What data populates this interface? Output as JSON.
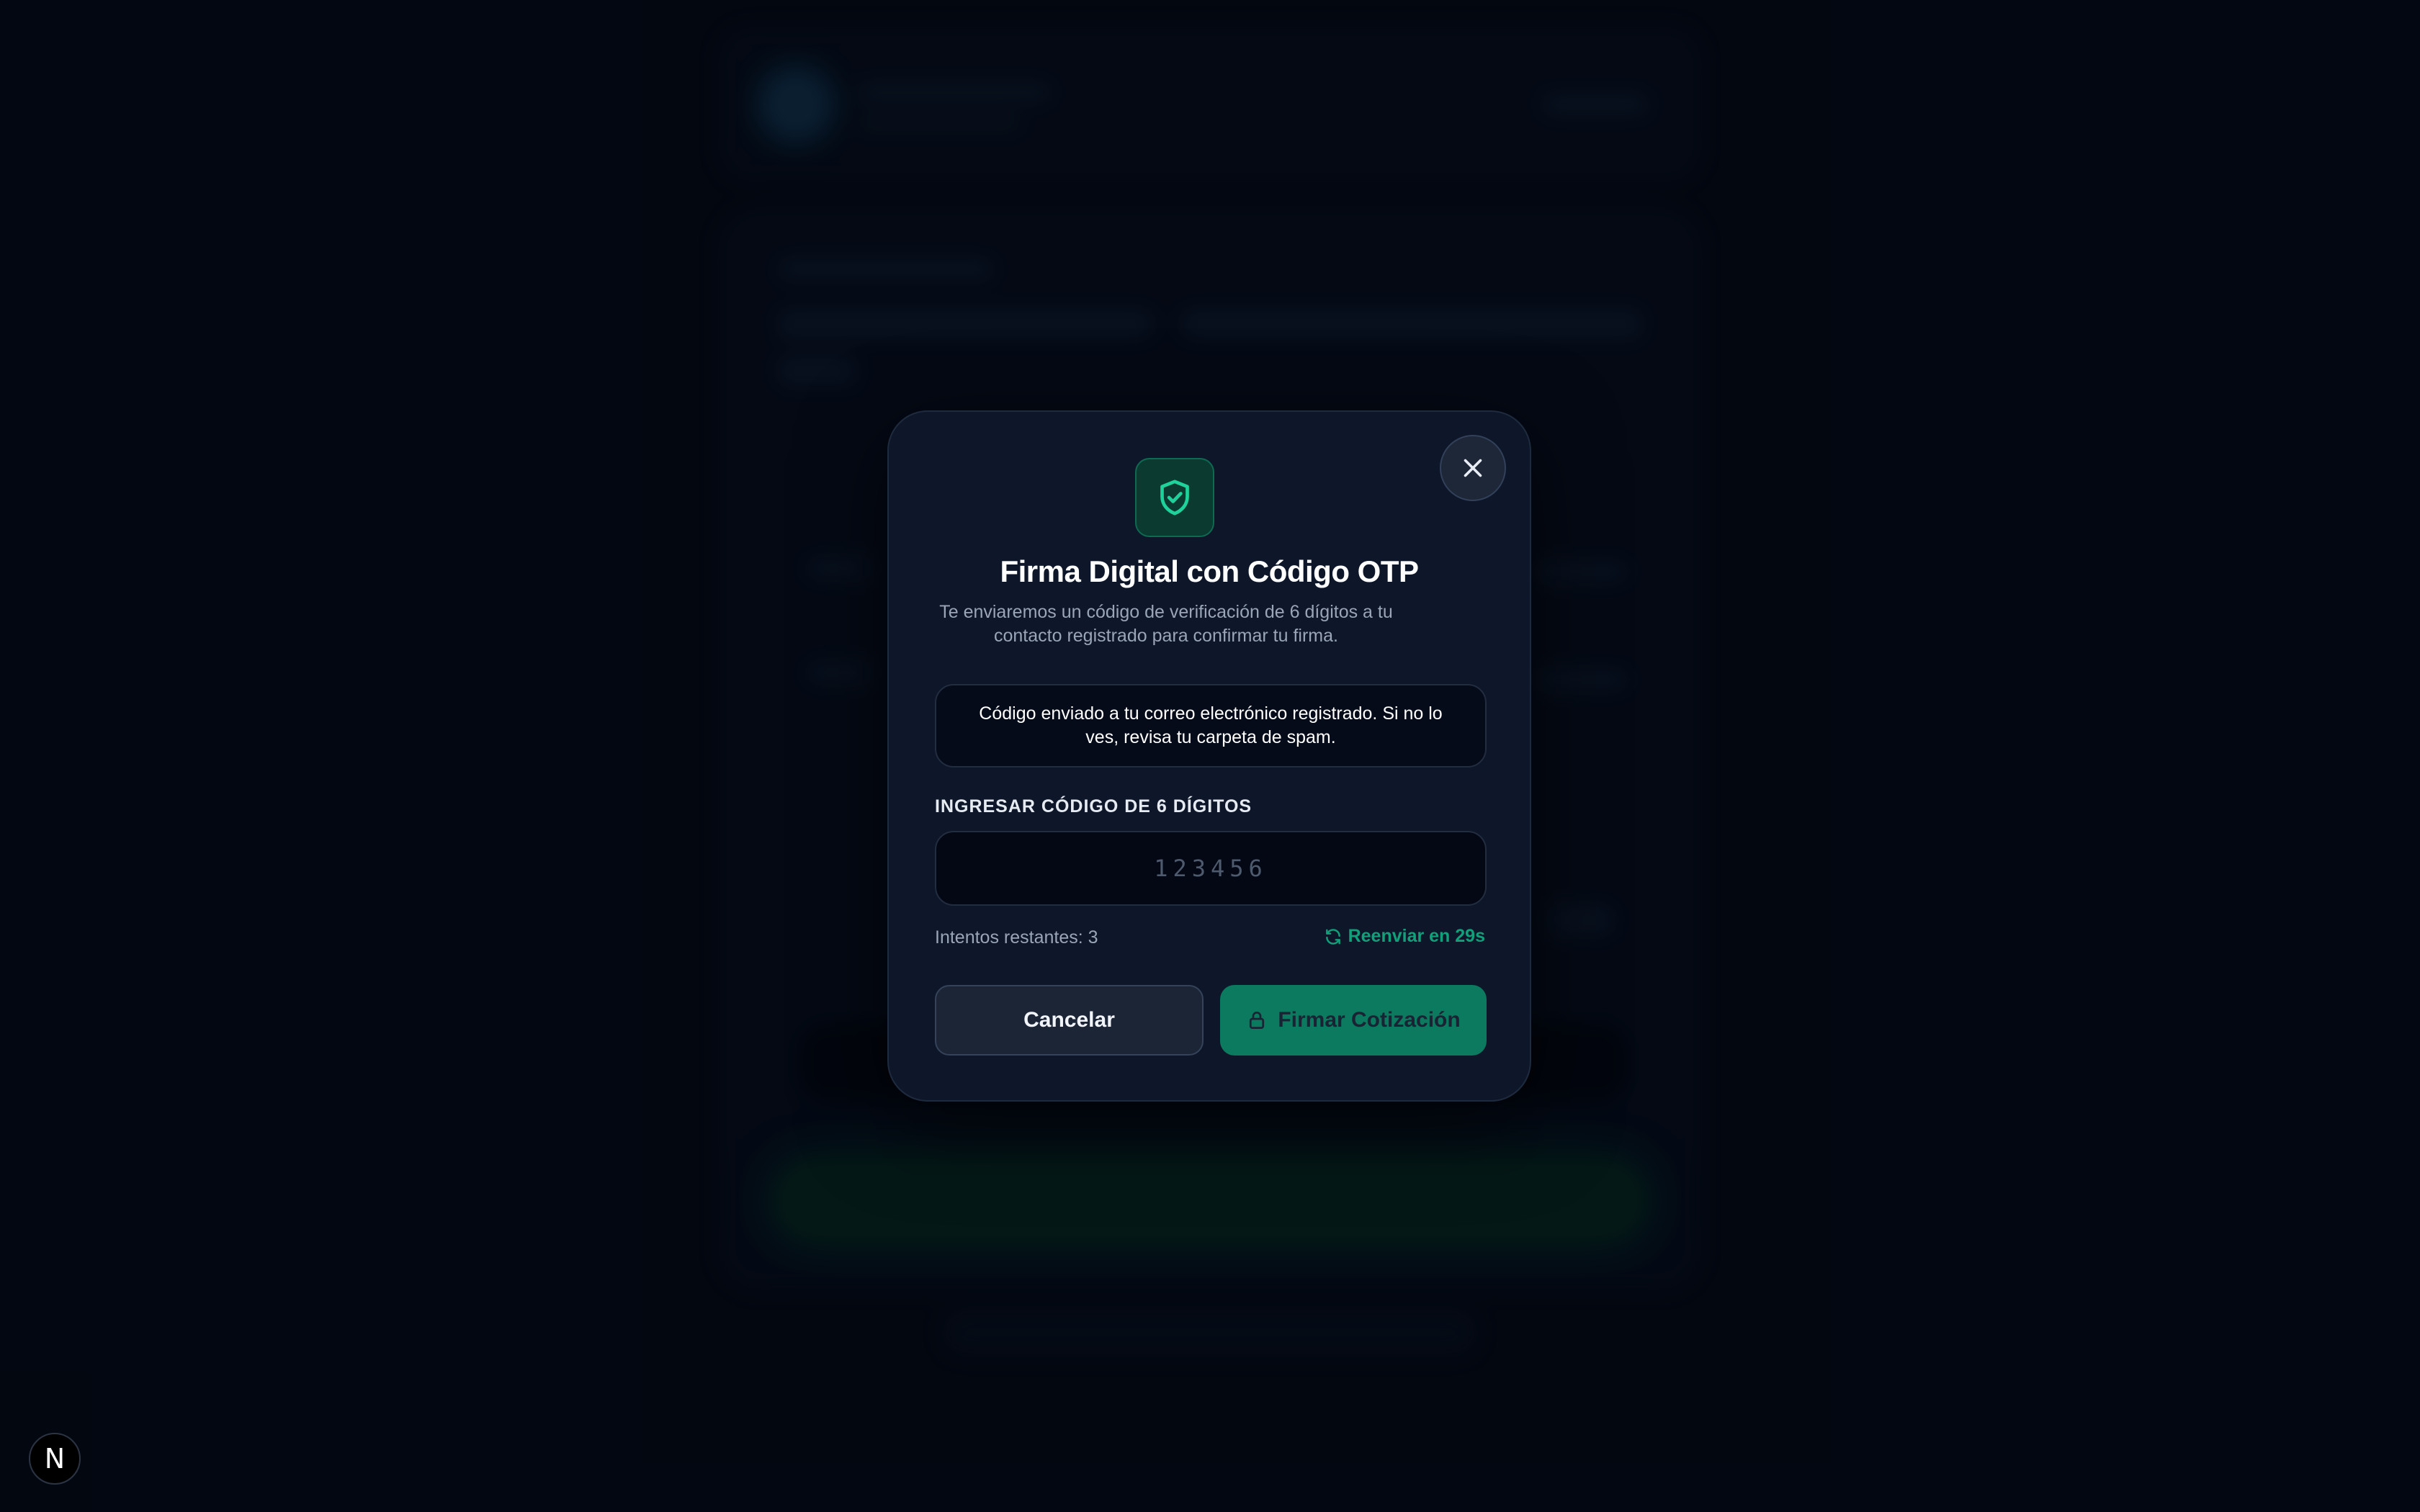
{
  "modal": {
    "title": "Firma Digital con Código OTP",
    "subtitle": "Te enviaremos un código de verificación de 6 dígitos a tu contacto registrado para confirmar tu firma.",
    "notice": "Código enviado a tu correo electrónico registrado. Si no lo ves, revisa tu carpeta de spam.",
    "code_label": "INGRESAR CÓDIGO DE 6 DÍGITOS",
    "code_placeholder": "123456",
    "code_value": "",
    "attempts": "Intentos restantes: 3",
    "resend": "Reenviar en 29s",
    "cancel_label": "Cancelar",
    "sign_label": "Firmar Cotización",
    "icons": {
      "close": "close-icon",
      "shield": "shield-check-icon",
      "refresh": "refresh-icon",
      "lock": "lock-icon"
    }
  },
  "badge": {
    "letter": "N"
  },
  "colors": {
    "background": "#030813",
    "modal": "#0e1729",
    "accent": "#0c7a5e",
    "accent_text": "#11a07a"
  }
}
